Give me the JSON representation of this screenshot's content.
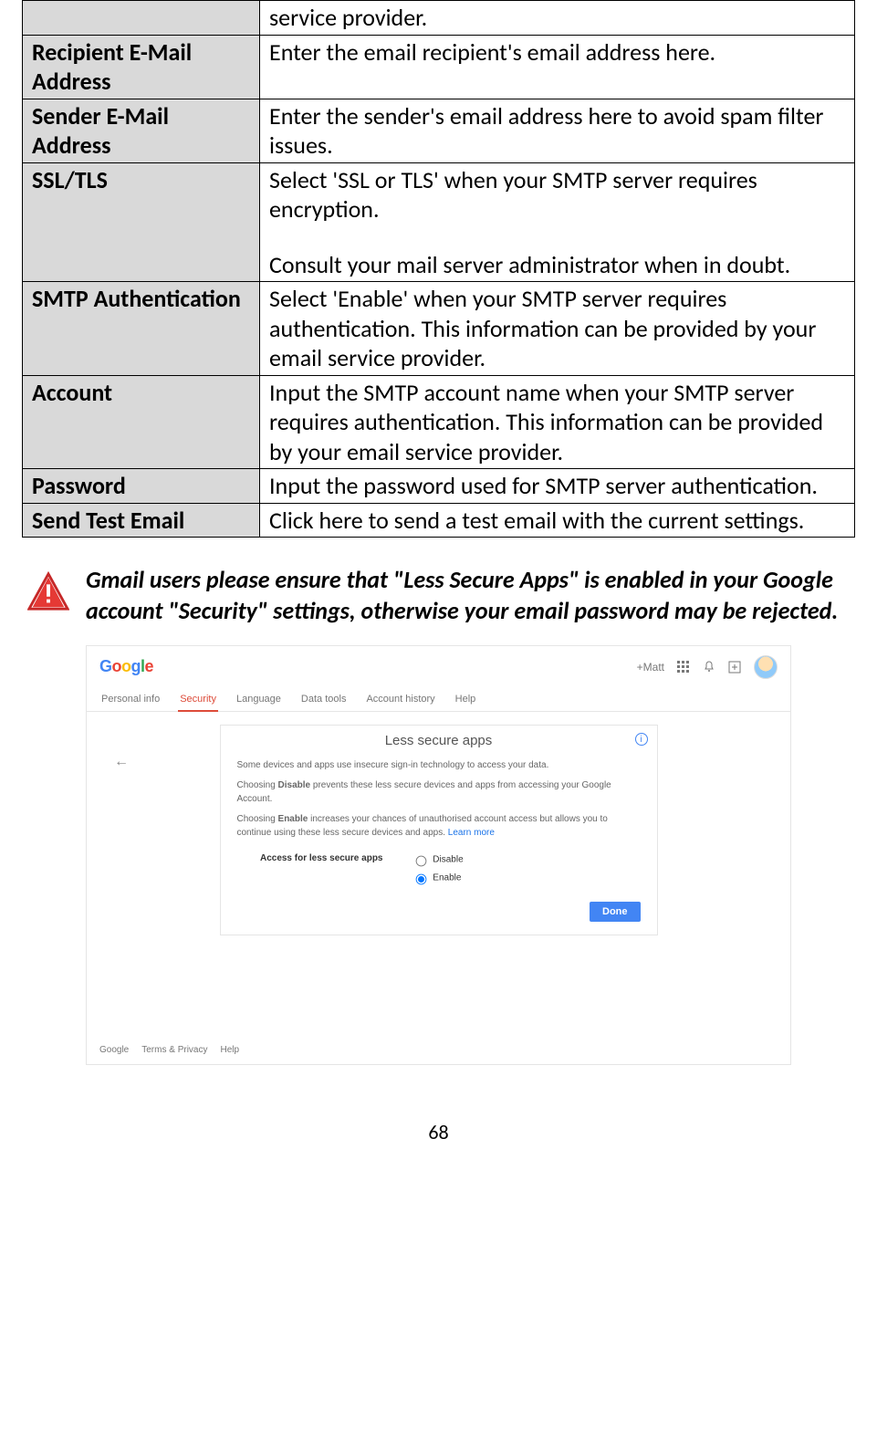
{
  "table": {
    "rows": [
      {
        "label": "",
        "desc": "service provider."
      },
      {
        "label": "Recipient E-Mail Address",
        "desc": "Enter the email recipient's email address here."
      },
      {
        "label": "Sender E-Mail Address",
        "desc": "Enter the sender's email address here to avoid spam filter issues."
      },
      {
        "label": "SSL/TLS",
        "desc_p1": "Select 'SSL or TLS' when your SMTP server requires encryption.",
        "desc_p2": "Consult your mail server administrator when in doubt."
      },
      {
        "label": "SMTP Authentication",
        "desc": "Select 'Enable' when your SMTP server requires authentication. This information can be provided by your email service provider."
      },
      {
        "label": "Account",
        "desc": "Input the SMTP account name when your SMTP server requires authentication. This information can be provided by your email service provider."
      },
      {
        "label": "Password",
        "desc": "Input the password used for SMTP server authentication."
      },
      {
        "label": "Send Test Email",
        "desc": "Click here to send a test email with the current settings."
      }
    ]
  },
  "warning": {
    "text": "Gmail users please ensure that \"Less Secure Apps\" is enabled in your Google account \"Security\" settings, otherwise your email password may be rejected."
  },
  "google_screenshot": {
    "logo_chars": [
      "G",
      "o",
      "o",
      "g",
      "l",
      "e"
    ],
    "top_right_user": "+Matt",
    "tabs": [
      "Personal info",
      "Security",
      "Language",
      "Data tools",
      "Account history",
      "Help"
    ],
    "active_tab_index": 1,
    "back_arrow": "←",
    "card": {
      "title": "Less secure apps",
      "info_glyph": "i",
      "p1": "Some devices and apps use insecure sign-in technology to access your data.",
      "p2_a": "Choosing ",
      "p2_b": "Disable",
      "p2_c": " prevents these less secure devices and apps from accessing your Google Account.",
      "p3_a": "Choosing ",
      "p3_b": "Enable",
      "p3_c": " increases your chances of unauthorised account access but allows you to continue using these less secure devices and apps. ",
      "p3_link": "Learn more",
      "radio_label": "Access for less secure apps",
      "radio_disable": "Disable",
      "radio_enable": "Enable",
      "done": "Done"
    },
    "footer": [
      "Google",
      "Terms & Privacy",
      "Help"
    ]
  },
  "page_number": "68"
}
